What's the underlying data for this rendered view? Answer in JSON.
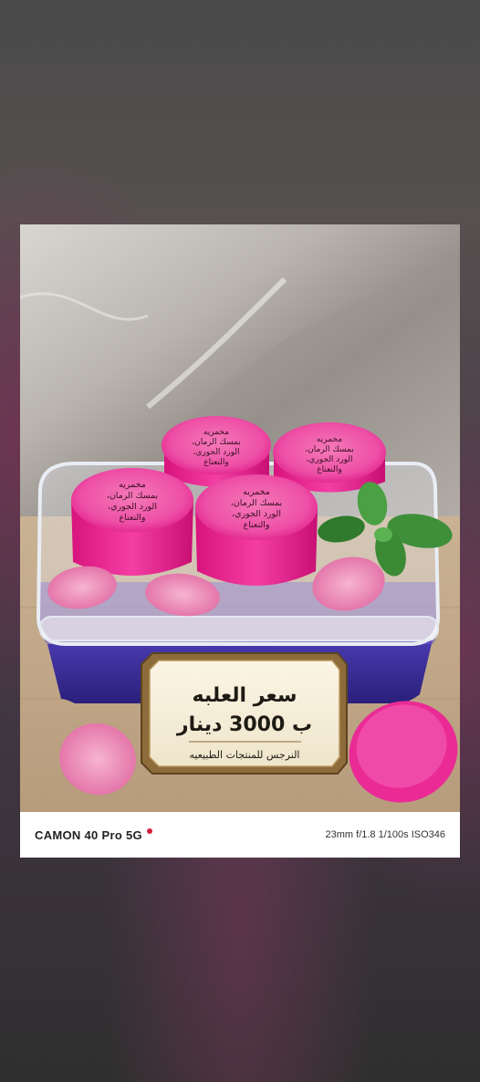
{
  "lid_label": [
    "مخمريه",
    "بمسك الرمان،",
    "الورد الجوري،",
    "والنعناع"
  ],
  "sign": {
    "line1": "سعر العلبه",
    "line2": "ب 3000 دينار",
    "line3": "النرجس للمنتجات الطبيعيه"
  },
  "camera": {
    "model": "CAMON 40 Pro 5G",
    "settings": "23mm f/1.8 1/100s ISO346"
  },
  "colors": {
    "lid_pink": "#f0239b",
    "gel_purple": "#3a2a9a",
    "mint": "#3f8f3a"
  }
}
